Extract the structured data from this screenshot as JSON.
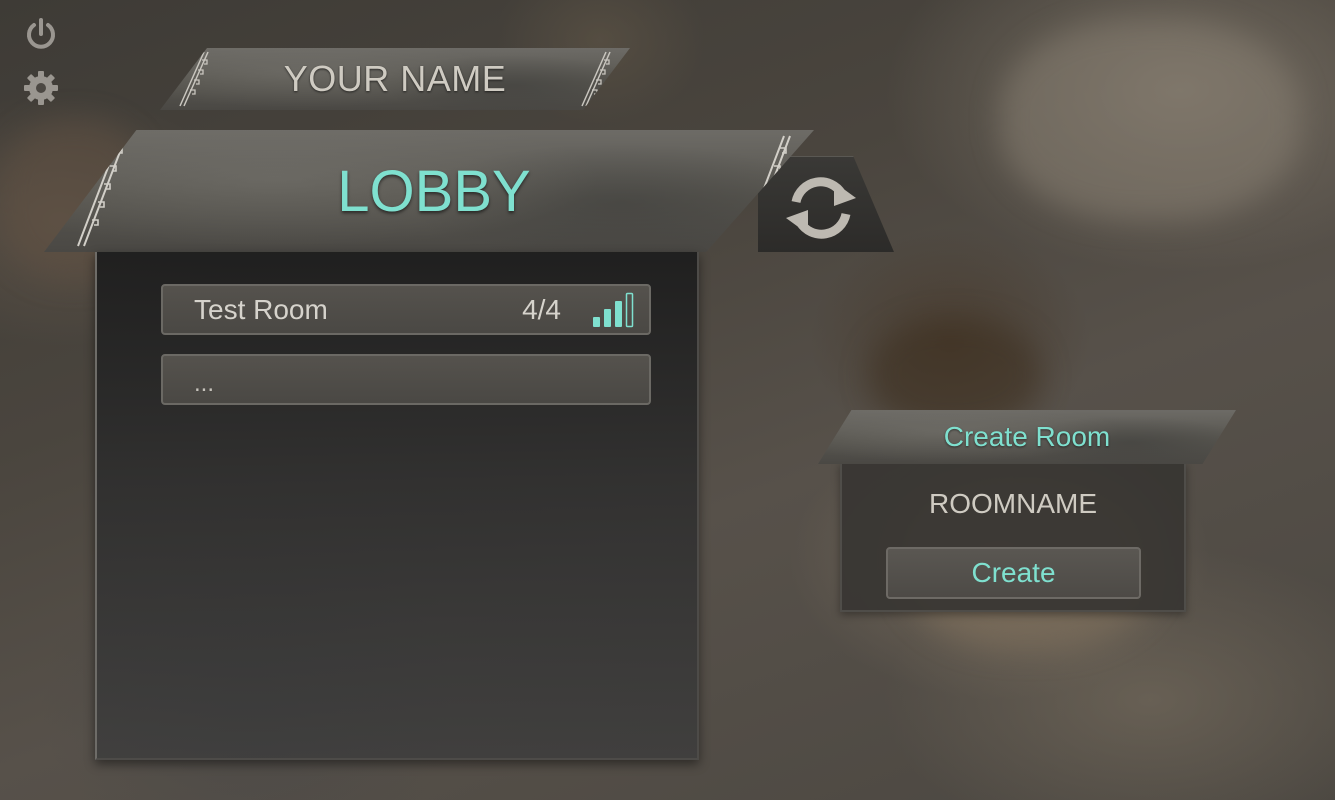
{
  "player": {
    "name_label": "YOUR NAME"
  },
  "lobby": {
    "title": "LOBBY",
    "rooms": [
      {
        "name": "Test Room",
        "players": "4/4",
        "signal_bars_filled": 3,
        "signal_bars_total": 4
      },
      {
        "name": "..."
      }
    ]
  },
  "create_room": {
    "title": "Create Room",
    "room_name_placeholder": "ROOMNAME",
    "create_label": "Create"
  },
  "icons": {
    "power": "power-icon",
    "settings": "gear-icon",
    "refresh": "refresh-icon",
    "signal": "signal-icon"
  },
  "colors": {
    "accent": "#7fe0cf",
    "text": "#d6d3cc"
  }
}
